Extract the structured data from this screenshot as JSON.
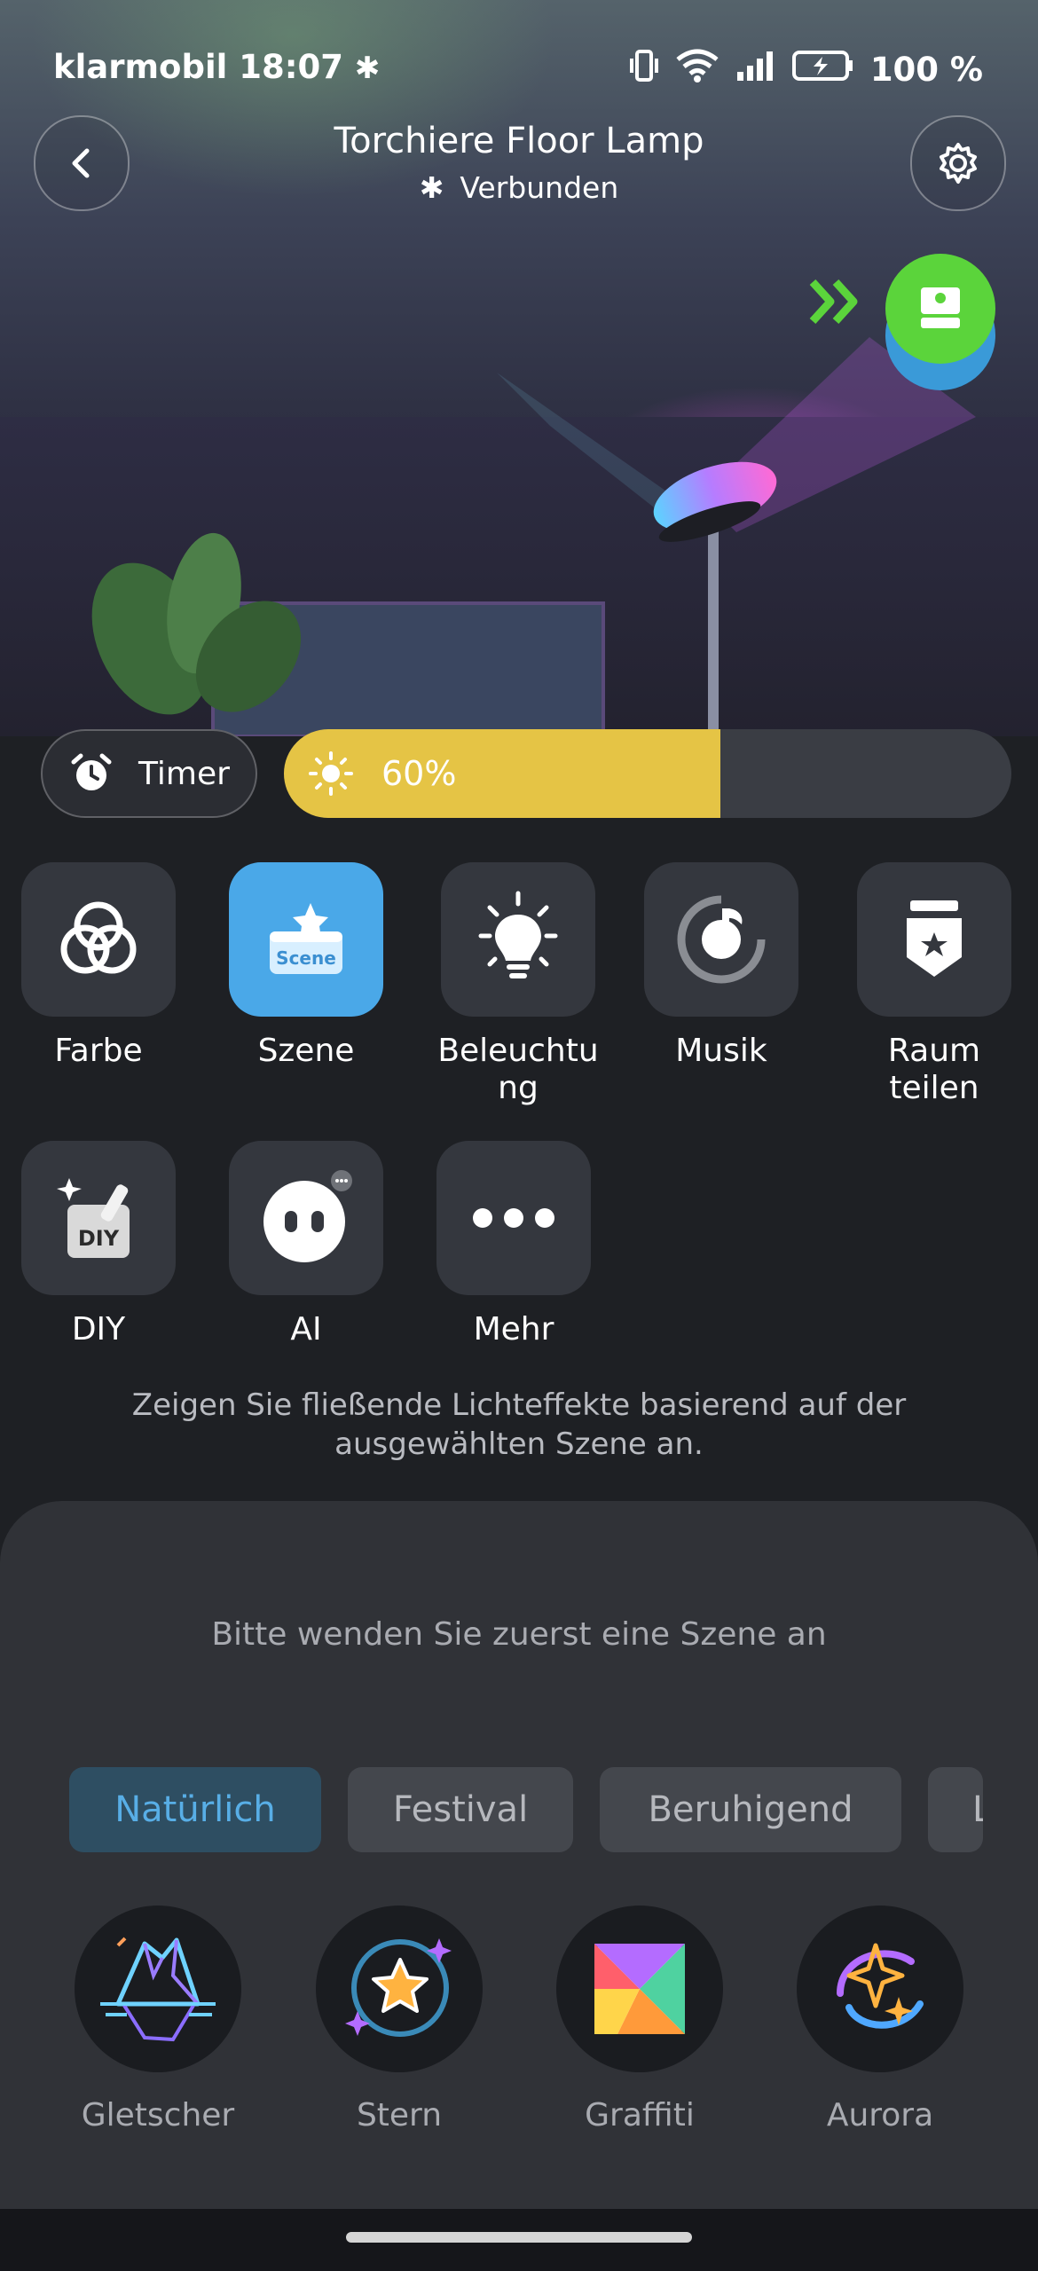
{
  "status_bar": {
    "carrier": "klarmobil",
    "time": "18:07",
    "battery": "100 %"
  },
  "header": {
    "title": "Torchiere Floor Lamp",
    "subtitle": "Verbunden"
  },
  "controls": {
    "timer_label": "Timer",
    "brightness_text": "60%",
    "brightness_value": 0.6
  },
  "features": [
    {
      "label": "Farbe",
      "icon": "color-rings-icon"
    },
    {
      "label": "Szene",
      "icon": "scene-icon",
      "active": true,
      "badge": "Scene"
    },
    {
      "label": "Beleuchtung",
      "icon": "lightbulb-icon"
    },
    {
      "label": "Musik",
      "icon": "music-icon"
    },
    {
      "label": "Raum teilen",
      "icon": "room-share-icon"
    },
    {
      "label": "DIY",
      "icon": "diy-icon",
      "badge": "DIY"
    },
    {
      "label": "AI",
      "icon": "ai-face-icon"
    },
    {
      "label": "Mehr",
      "icon": "more-dots-icon"
    }
  ],
  "description": "Zeigen Sie fließende Lichteffekte basierend auf der ausgewählten Szene an.",
  "sheet": {
    "message": "Bitte wenden Sie zuerst eine Szene an",
    "categories": [
      "Natürlich",
      "Festival",
      "Beruhigend",
      "L"
    ],
    "scenes": [
      {
        "label": "Gletscher",
        "icon": "glacier-icon"
      },
      {
        "label": "Stern",
        "icon": "star-icon"
      },
      {
        "label": "Graffiti",
        "icon": "graffiti-icon"
      },
      {
        "label": "Aurora",
        "icon": "aurora-icon"
      }
    ]
  },
  "colors": {
    "accent": "#4aa8e8",
    "brightness": "#e5c445",
    "active_chip_text": "#58aee6"
  }
}
